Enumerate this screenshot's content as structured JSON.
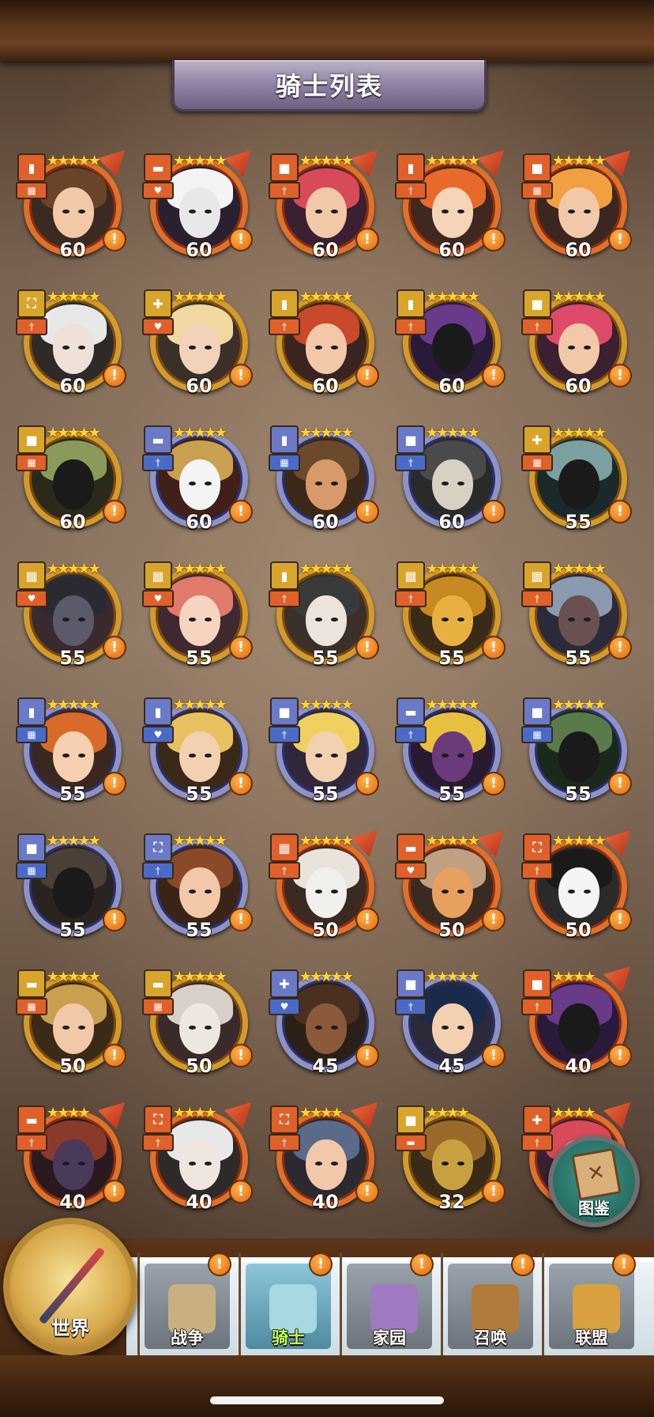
{
  "header": {
    "title": "骑士列表"
  },
  "knights": [
    {
      "level": "60",
      "stars": 5,
      "tier": "red",
      "class": "▮",
      "role": "▦",
      "skin": "#f2c8a8",
      "hair": "#6a4428",
      "bg": "#3a2a22"
    },
    {
      "level": "60",
      "stars": 5,
      "tier": "red",
      "class": "▬",
      "role": "♥",
      "skin": "#e8e8e8",
      "hair": "#f4f4f4",
      "bg": "#2a2030"
    },
    {
      "level": "60",
      "stars": 5,
      "tier": "red",
      "class": "■",
      "role": "†",
      "skin": "#f2c8a8",
      "hair": "#d84a5a",
      "bg": "#3a2030"
    },
    {
      "level": "60",
      "stars": 5,
      "tier": "red",
      "class": "▮",
      "role": "†",
      "skin": "#f6d4b8",
      "hair": "#e86a2a",
      "bg": "#402820"
    },
    {
      "level": "60",
      "stars": 5,
      "tier": "red",
      "class": "■",
      "role": "▦",
      "skin": "#f2c8a8",
      "hair": "#f0a040",
      "bg": "#3a2820"
    },
    {
      "level": "60",
      "stars": 5,
      "tier": "gold",
      "class": "⛶",
      "role": "†",
      "skin": "#efe0d8",
      "hair": "#e8e8e8",
      "bg": "#2e2a28"
    },
    {
      "level": "60",
      "stars": 5,
      "tier": "gold",
      "class": "✚",
      "role": "♥",
      "skin": "#f2d2b8",
      "hair": "#f0d8a0",
      "bg": "#3a3028"
    },
    {
      "level": "60",
      "stars": 5,
      "tier": "gold",
      "class": "▮",
      "role": "†",
      "skin": "#f2c8a8",
      "hair": "#c84a2a",
      "bg": "#3a2420"
    },
    {
      "level": "60",
      "stars": 5,
      "tier": "gold",
      "class": "▮",
      "role": "†",
      "skin": "#1a1a1a",
      "hair": "#6a3a8a",
      "bg": "#2a1a3a"
    },
    {
      "level": "60",
      "stars": 5,
      "tier": "gold",
      "class": "■",
      "role": "†",
      "skin": "#f2c8a8",
      "hair": "#e04a6a",
      "bg": "#3a2030"
    },
    {
      "level": "60",
      "stars": 5,
      "tier": "gold",
      "class": "■",
      "role": "▦",
      "skin": "#1a1a1a",
      "hair": "#8a9a5a",
      "bg": "#2a2a1a"
    },
    {
      "level": "60",
      "stars": 5,
      "tier": "blue",
      "class": "▬",
      "role": "†",
      "skin": "#f4f4f4",
      "hair": "#c8a050",
      "bg": "#402018"
    },
    {
      "level": "60",
      "stars": 5,
      "tier": "blue",
      "class": "▮",
      "role": "▦",
      "skin": "#d89a6a",
      "hair": "#6a4a2a",
      "bg": "#3a2818"
    },
    {
      "level": "60",
      "stars": 5,
      "tier": "blue",
      "class": "■",
      "role": "†",
      "skin": "#d8d0c0",
      "hair": "#4a4a4a",
      "bg": "#2a2a2a"
    },
    {
      "level": "55",
      "stars": 5,
      "tier": "gold",
      "class": "✚",
      "role": "▦",
      "skin": "#1a1a1a",
      "hair": "#7aa0a0",
      "bg": "#1a2a2a"
    },
    {
      "level": "55",
      "stars": 5,
      "tier": "gold",
      "class": "▦",
      "role": "♥",
      "skin": "#5a5a6a",
      "hair": "#2a2a32",
      "bg": "#3a2a30"
    },
    {
      "level": "55",
      "stars": 5,
      "tier": "gold",
      "class": "▦",
      "role": "♥",
      "skin": "#f6d4c0",
      "hair": "#e07a6a",
      "bg": "#402830"
    },
    {
      "level": "55",
      "stars": 5,
      "tier": "gold",
      "class": "▮",
      "role": "†",
      "skin": "#ece4dc",
      "hair": "#3a3a3a",
      "bg": "#3a3028"
    },
    {
      "level": "55",
      "stars": 5,
      "tier": "gold",
      "class": "▦",
      "role": "†",
      "skin": "#e8b040",
      "hair": "#c88a20",
      "bg": "#3a2a18"
    },
    {
      "level": "55",
      "stars": 5,
      "tier": "gold",
      "class": "▦",
      "role": "†",
      "skin": "#6a5050",
      "hair": "#8a9ab0",
      "bg": "#2a2a3a"
    },
    {
      "level": "55",
      "stars": 5,
      "tier": "blue",
      "class": "▮",
      "role": "▦",
      "skin": "#f6d0b0",
      "hair": "#d86a2a",
      "bg": "#3a2820"
    },
    {
      "level": "55",
      "stars": 5,
      "tier": "blue",
      "class": "▮",
      "role": "♥",
      "skin": "#f2d0b0",
      "hair": "#e8c060",
      "bg": "#3a2818"
    },
    {
      "level": "55",
      "stars": 5,
      "tier": "blue",
      "class": "■",
      "role": "†",
      "skin": "#f2d0b0",
      "hair": "#f0d060",
      "bg": "#30283a"
    },
    {
      "level": "55",
      "stars": 5,
      "tier": "blue",
      "class": "▬",
      "role": "†",
      "skin": "#6a3a7a",
      "hair": "#e8c040",
      "bg": "#2a1a30"
    },
    {
      "level": "55",
      "stars": 5,
      "tier": "blue",
      "class": "■",
      "role": "▦",
      "skin": "#1a1a1a",
      "hair": "#5a7a4a",
      "bg": "#1a2a1a"
    },
    {
      "level": "55",
      "stars": 5,
      "tier": "blue",
      "class": "■",
      "role": "▦",
      "skin": "#1a1a1a",
      "hair": "#4a4038",
      "bg": "#2a2420"
    },
    {
      "level": "55",
      "stars": 5,
      "tier": "blue",
      "class": "⛶",
      "role": "†",
      "skin": "#f2c8a8",
      "hair": "#8a4a2a",
      "bg": "#3a2418"
    },
    {
      "level": "50",
      "stars": 5,
      "tier": "red",
      "class": "▦",
      "role": "†",
      "skin": "#f2f0ec",
      "hair": "#e8e4dc",
      "bg": "#3a2a22"
    },
    {
      "level": "50",
      "stars": 5,
      "tier": "red",
      "class": "▬",
      "role": "♥",
      "skin": "#e8a060",
      "hair": "#c0a080",
      "bg": "#3a2a20"
    },
    {
      "level": "50",
      "stars": 5,
      "tier": "red",
      "class": "⛶",
      "role": "†",
      "skin": "#f4f4f4",
      "hair": "#1a1a1a",
      "bg": "#2a2a2a"
    },
    {
      "level": "50",
      "stars": 5,
      "tier": "gold",
      "class": "▬",
      "role": "▦",
      "skin": "#f2c8a8",
      "hair": "#c8a050",
      "bg": "#3a2a18"
    },
    {
      "level": "50",
      "stars": 5,
      "tier": "gold",
      "class": "▬",
      "role": "▦",
      "skin": "#f0e6e0",
      "hair": "#d8d0c8",
      "bg": "#3a2a2a"
    },
    {
      "level": "45",
      "stars": 5,
      "tier": "blue",
      "class": "✚",
      "role": "♥",
      "skin": "#8a5a3a",
      "hair": "#4a3020",
      "bg": "#2a2018"
    },
    {
      "level": "45",
      "stars": 5,
      "tier": "blue",
      "class": "■",
      "role": "†",
      "skin": "#f2d0b0",
      "hair": "#1a2a4a",
      "bg": "#2a2a3a"
    },
    {
      "level": "40",
      "stars": 4,
      "tier": "red",
      "class": "■",
      "role": "†",
      "skin": "#1a1a1a",
      "hair": "#6a3a8a",
      "bg": "#2a1a3a"
    },
    {
      "level": "40",
      "stars": 4,
      "tier": "red",
      "class": "▬",
      "role": "†",
      "skin": "#4a3a5a",
      "hair": "#8a3a2a",
      "bg": "#2a1a20"
    },
    {
      "level": "40",
      "stars": 4,
      "tier": "red",
      "class": "⛶",
      "role": "†",
      "skin": "#efe6e0",
      "hair": "#e8e8e8",
      "bg": "#2e2a2a"
    },
    {
      "level": "40",
      "stars": 4,
      "tier": "red",
      "class": "⛶",
      "role": "†",
      "skin": "#f2c8a8",
      "hair": "#5a6a8a",
      "bg": "#2a2a30"
    },
    {
      "level": "32",
      "stars": 4,
      "tier": "gold",
      "class": "■",
      "role": "▬",
      "skin": "#c8a040",
      "hair": "#9a6a2a",
      "bg": "#3a2a18"
    },
    {
      "level": "",
      "stars": 4,
      "tier": "red",
      "class": "✚",
      "role": "†",
      "skin": "#f2c8a8",
      "hair": "#d84a5a",
      "bg": "#3a2030"
    }
  ],
  "atlas_button": {
    "label": "图鉴",
    "icon": "✕"
  },
  "nav": {
    "world": "世界",
    "items": [
      {
        "label": "战争",
        "color": "#c8b080"
      },
      {
        "label": "骑士",
        "color": "#a8d8e0"
      },
      {
        "label": "家园",
        "color": "#a07ac0"
      },
      {
        "label": "召唤",
        "color": "#b07a3a"
      },
      {
        "label": "联盟",
        "color": "#d8a040"
      }
    ],
    "alert": "!"
  },
  "alert_glyph": "!"
}
